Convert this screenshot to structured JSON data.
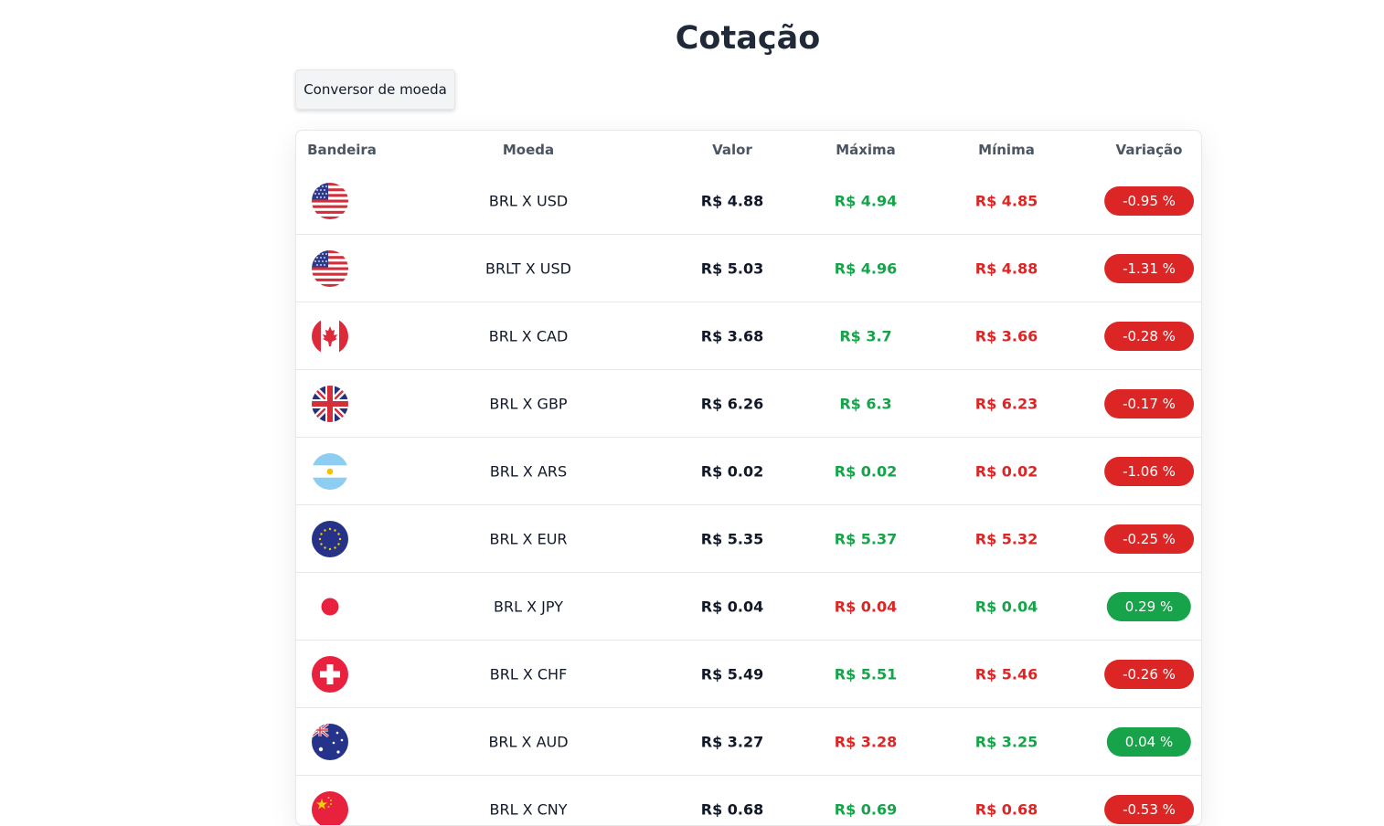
{
  "title": "Cotação",
  "converter_button": "Conversor de moeda",
  "columns": {
    "flag": "Bandeira",
    "pair": "Moeda",
    "value": "Valor",
    "max": "Máxima",
    "min": "Mínima",
    "change": "Variação"
  },
  "colors": {
    "positive": "#16a34a",
    "negative": "#dc2626"
  },
  "rows": [
    {
      "flag": "us-flag-icon",
      "pair": "BRL X USD",
      "value": "R$ 4.88",
      "max": "R$ 4.94",
      "min": "R$ 4.85",
      "change": "-0.95 %"
    },
    {
      "flag": "us-flag-icon",
      "pair": "BRLT X USD",
      "value": "R$ 5.03",
      "max": "R$ 4.96",
      "min": "R$ 4.88",
      "change": "-1.31 %"
    },
    {
      "flag": "canada-flag-icon",
      "pair": "BRL X CAD",
      "value": "R$ 3.68",
      "max": "R$ 3.7",
      "min": "R$ 3.66",
      "change": "-0.28 %"
    },
    {
      "flag": "uk-flag-icon",
      "pair": "BRL X GBP",
      "value": "R$ 6.26",
      "max": "R$ 6.3",
      "min": "R$ 6.23",
      "change": "-0.17 %"
    },
    {
      "flag": "argentina-flag-icon",
      "pair": "BRL X ARS",
      "value": "R$ 0.02",
      "max": "R$ 0.02",
      "min": "R$ 0.02",
      "change": "-1.06 %"
    },
    {
      "flag": "eu-flag-icon",
      "pair": "BRL X EUR",
      "value": "R$ 5.35",
      "max": "R$ 5.37",
      "min": "R$ 5.32",
      "change": "-0.25 %"
    },
    {
      "flag": "japan-flag-icon",
      "pair": "BRL X JPY",
      "value": "R$ 0.04",
      "max": "R$ 0.04",
      "min": "R$ 0.04",
      "change": "0.29 %"
    },
    {
      "flag": "switzerland-flag-icon",
      "pair": "BRL X CHF",
      "value": "R$ 5.49",
      "max": "R$ 5.51",
      "min": "R$ 5.46",
      "change": "-0.26 %"
    },
    {
      "flag": "australia-flag-icon",
      "pair": "BRL X AUD",
      "value": "R$ 3.27",
      "max": "R$ 3.28",
      "min": "R$ 3.25",
      "change": "0.04 %"
    },
    {
      "flag": "china-flag-icon",
      "pair": "BRL X CNY",
      "value": "R$ 0.68",
      "max": "R$ 0.69",
      "min": "R$ 0.68",
      "change": "-0.53 %"
    }
  ]
}
